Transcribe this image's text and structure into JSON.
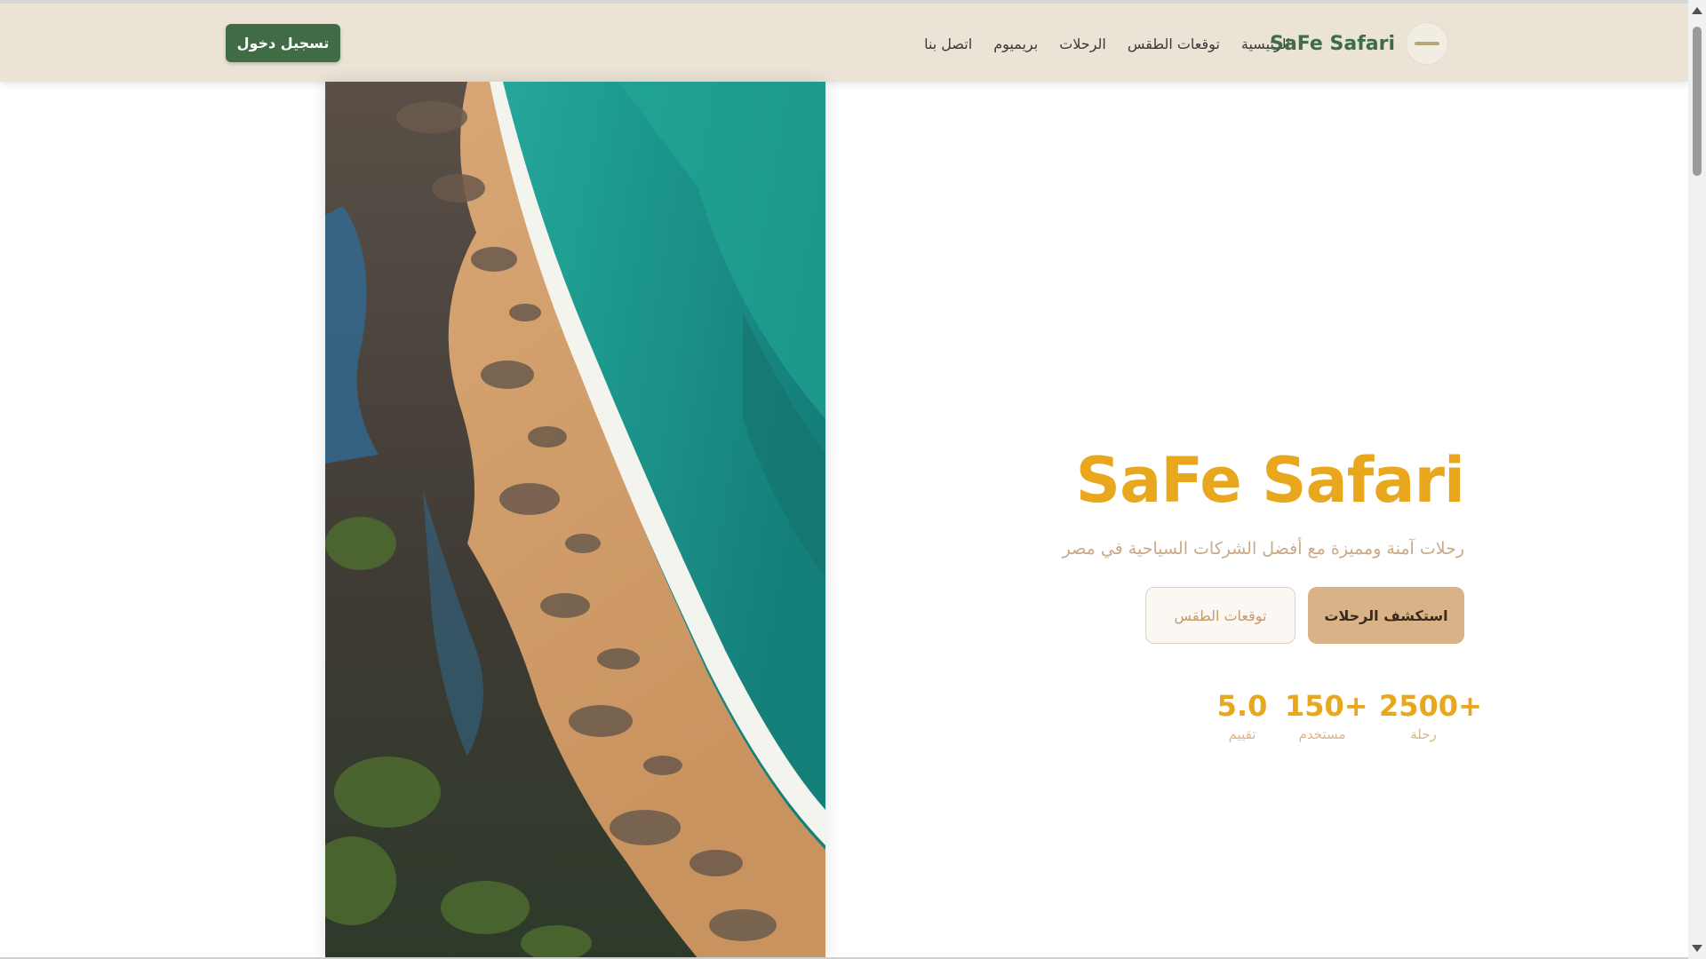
{
  "navbar": {
    "brand_name": "SaFe Safari",
    "links": [
      {
        "label": "الرئيسية"
      },
      {
        "label": "توقعات الطقس"
      },
      {
        "label": "الرحلات"
      },
      {
        "label": "بريميوم"
      },
      {
        "label": "اتصل بنا"
      }
    ],
    "login_label": "تسجيل دخول"
  },
  "hero": {
    "title": "SaFe Safari",
    "subtitle": "رحلات آمنة ومميزة مع أفضل الشركات السياحية في مصر",
    "explore_label": "استكشف الرحلات",
    "weather_label": "توقعات الطقس",
    "stats": [
      {
        "value": "2500+",
        "label": "رحلة"
      },
      {
        "value": "150+",
        "label": "مستخدم"
      },
      {
        "value": "5.0",
        "label": "تقييم"
      }
    ]
  },
  "colors": {
    "brand_green": "#3f6b45",
    "accent_gold": "#e8a71c",
    "navbar_bg": "#ebe3d6",
    "button_tan": "#d9b387"
  }
}
